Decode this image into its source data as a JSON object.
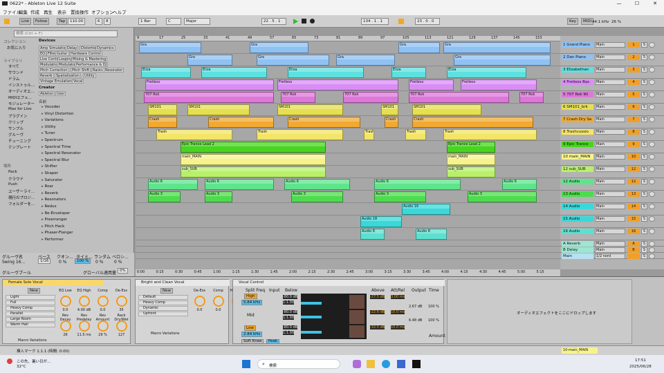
{
  "window": {
    "title": "0622* - Ableton Live 12 Suite",
    "min": "—",
    "max": "☐",
    "close": "✕"
  },
  "menu": [
    "ファイル",
    "編集",
    "作成",
    "再生",
    "表示",
    "置換操作",
    "オプション",
    "ヘルプ"
  ],
  "control": {
    "link": "Link",
    "follow": "Follow",
    "tap": "Tap",
    "tempo": "110.00",
    "sig_num": "6",
    "sig_den": "8",
    "quant": "1 Bar",
    "key": "C",
    "scale": "Major",
    "position": "22 . 5 . 1",
    "loop_start": "134 . 1 . 1",
    "loop_len": "23 . 0 . 0",
    "key_btn": "Key",
    "midi_btn": "MIDI",
    "sample_rate": "44.1 kHz",
    "cpu": "26 %"
  },
  "browser": {
    "search_placeholder": "検索 (Ctrl + F)",
    "collections_header": "コレクション",
    "favorites": "お気に入り",
    "library_header": "ライブラリ",
    "library": [
      "すべて",
      "サウンド",
      "ドラム",
      "インストゥル...",
      "オーディオエ...",
      "MIDIエフェ...",
      "モジュレーター",
      "Max for Live",
      "プラグイン",
      "クリップ",
      "サンプル",
      "グルーヴ",
      "チューニング",
      "テンプレート"
    ],
    "places_header": "場所",
    "places": [
      "Pack",
      "クラウド",
      "Push",
      "ユーザーライ...",
      "現行のプロジ...",
      "フォルダーを..."
    ],
    "devices_header": "Devices",
    "tags": [
      "Amp Simulation",
      "Delay",
      "Distortion",
      "Dynamics",
      "EQ",
      "Filter",
      "Guitar",
      "Hardware Control",
      "Live Control",
      "Looping",
      "Mixing & Mastering",
      "Modulation",
      "Modulator",
      "Performance & DJ",
      "Pitch Correction",
      "Pitch Shift",
      "Racks",
      "Resonator",
      "Reverb",
      "Spatialization",
      "Utility",
      "Vintage Emulation",
      "Vocal"
    ],
    "creator_header": "Creator",
    "creators": [
      "Ableton",
      "User"
    ],
    "name_col": "名前",
    "items": [
      "Vocoder",
      "Vinyl Distortion",
      "Variations",
      "Utility",
      "Tuner",
      "Spectrum",
      "Spectral Time",
      "Spectral Resonator",
      "Spectral Blur",
      "Shifter",
      "Shaper",
      "Saturator",
      "Roar",
      "Reverb",
      "Resonators",
      "Redux",
      "Re-Enveloper",
      "Prearranger",
      "Pitch Hack",
      "Phaser-Flanger",
      "Performer"
    ]
  },
  "groove": {
    "headers": [
      "グルーヴ名",
      "ベース",
      "クオン...",
      "タイミ...",
      "ランダム",
      "ベロシ..."
    ],
    "row": {
      "name": "Swing 16...",
      "base": "1/16",
      "quant": "0 %",
      "timing": "100 %",
      "random": "0 %",
      "velocity": "0 %"
    },
    "pool": "グルーヴプール",
    "global_amount_label": "グローバル適用量",
    "global_amount": "0%"
  },
  "ruler": [
    "9",
    "17",
    "25",
    "33",
    "41",
    "49",
    "57",
    "65",
    "73",
    "81",
    "89",
    "97",
    "105",
    "113",
    "121",
    "129",
    "137",
    "145",
    "153"
  ],
  "timeline": [
    "0:00",
    "0:15",
    "0:30",
    "0:45",
    "1:00",
    "1:15",
    "1:30",
    "1:45",
    "2:00",
    "2:15",
    "2:30",
    "2:45",
    "3:00",
    "3:15",
    "3:30",
    "3:45",
    "4:00",
    "4:15",
    "4:30",
    "4:45",
    "5:00",
    "5:15"
  ],
  "tracks": [
    {
      "name": "1 Grand Piano",
      "io": "Main",
      "num": "1",
      "color": "#8fc1f3",
      "clip": "Gra"
    },
    {
      "name": "2 Dan Piano",
      "io": "Main",
      "num": "2",
      "color": "#8fc1f3",
      "clip": "Gra"
    },
    {
      "name": "3 Elizabethan",
      "io": "Main",
      "num": "3",
      "color": "#5de0e0",
      "clip": "Eliza"
    },
    {
      "name": "4 Fretless Bas",
      "io": "Main",
      "num": "4",
      "color": "#d98ef5",
      "clip": "Fretless"
    },
    {
      "name": "5 707 Rok Wi",
      "io": "Main",
      "num": "5",
      "color": "#dd77d9",
      "clip": "707 Rok"
    },
    {
      "name": "6 SM101_brk",
      "io": "Main",
      "num": "6",
      "color": "#e6df4f",
      "clip": "SM101"
    },
    {
      "name": "7 Crash Dry Sa",
      "io": "Main",
      "num": "7",
      "color": "#f1a932",
      "clip": "Crash"
    },
    {
      "name": "8 Trashcussio",
      "io": "Main",
      "num": "8",
      "color": "#f3e566",
      "clip": "Trash"
    },
    {
      "name": "9 Epic Trance",
      "io": "Main",
      "num": "9",
      "color": "#47d61e",
      "clip": "Epic Trance Lead 2"
    },
    {
      "name": "10 main_MAIN",
      "io": "Main",
      "num": "10",
      "color": "#f6f38d",
      "clip": "main_MAIN"
    },
    {
      "name": "12 sub_SUB",
      "io": "Main",
      "num": "12",
      "color": "#b8f06a",
      "clip": "sub_SUB"
    },
    {
      "name": "12 Audio",
      "io": "Main",
      "num": "12",
      "color": "#5ee58b",
      "clip": "Audio 6"
    },
    {
      "name": "13 Audio",
      "io": "Main",
      "num": "13",
      "color": "#4ddc4d",
      "clip": "Audio 3"
    },
    {
      "name": "14 Audio",
      "io": "Main",
      "num": "14",
      "color": "#3ad8d8",
      "clip": "Audio 16"
    },
    {
      "name": "15 Audio",
      "io": "Main",
      "num": "15",
      "color": "#3ad8d8",
      "clip": "Audio 18"
    },
    {
      "name": "16 Audio",
      "io": "Main",
      "num": "16",
      "color": "#5de0d0",
      "clip": "Audio 8"
    },
    {
      "name": "A Reverb",
      "io": "Main",
      "num": "A",
      "color": "#9ce6d3",
      "clip": ""
    },
    {
      "name": "B Delay",
      "io": "Main",
      "num": "B",
      "color": "#9ce6d3",
      "clip": ""
    },
    {
      "name": "Main",
      "io": "1/2 nord",
      "num": "",
      "color": "#b8e0f3",
      "clip": ""
    }
  ],
  "devices": {
    "rack1": {
      "title": "Female Solo Vocal",
      "chains": [
        "Light",
        "Full",
        "Heavy Comp",
        "Parallel",
        "Large Room",
        "Warm Hall"
      ],
      "new": "New",
      "macro_footer": "Macro Variations",
      "macros": [
        {
          "label": "EQ Low",
          "val": "0.0"
        },
        {
          "label": "EQ High",
          "val": "4.00 dB"
        },
        {
          "label": "Comp",
          "val": "0.0"
        },
        {
          "label": "De-Ess",
          "val": "35"
        },
        {
          "label": "Rev Decay",
          "val": "26"
        },
        {
          "label": "Rev Predelay",
          "val": "11.5 ms"
        },
        {
          "label": "Rev Amount",
          "val": "29 %"
        },
        {
          "label": "Rack Dry/Wet",
          "val": "127"
        }
      ]
    },
    "rack2": {
      "title": "Bright and Clean Vocal",
      "chains": [
        "Default",
        "Heavy Comp",
        "Dynamic",
        "Upfront"
      ],
      "new": "New",
      "macro_footer": "Macro Variations",
      "macros": [
        {
          "label": "De-Ess",
          "val": "0.0"
        },
        {
          "label": "Comp",
          "val": "0.0"
        },
        {
          "label": "High EQ",
          "val": "77"
        },
        {
          "label": "Air",
          "val": "51"
        }
      ]
    },
    "vocal": {
      "title": "Vocal Control",
      "split": "Split Freq",
      "high": "High",
      "high_val": "5.84 kHz",
      "mid": "Mid",
      "low": "Low",
      "low_val": "2.84 kHz",
      "soft": "Soft Knee",
      "peak": "Peak",
      "input": "Input",
      "below": "Below",
      "above": "Above",
      "attrel": "Att/Rel",
      "output": "Output",
      "time": "Time",
      "amount": "Amount",
      "rows": [
        {
          "b": "-80.0 dB",
          "r": "1:1.00",
          "a": "-27.5 dB",
          "ar": "3.00 ms"
        },
        {
          "b": "-80.0 dB",
          "r": "1:1.00",
          "a": "-22.6 dB",
          "ar": "10.0 ms"
        },
        {
          "b": "-80.0 dB",
          "r": "1:1.00",
          "a": "-32.5 dB",
          "ar": "10.0 ms"
        }
      ],
      "out_vals": [
        "2.67 dB",
        "6.48 dB",
        "100 %",
        "100 %"
      ]
    },
    "drop_hint": "オーディオエフェクトをここにドロップします"
  },
  "status": {
    "left": "挿入マーク 1.1.1 (時間: 0:00)",
    "right_track": "10-main_MAIN"
  },
  "taskbar": {
    "weather_title": "この先、暑い日が...",
    "weather_temp": "32°C",
    "search": "検索",
    "time": "17:51",
    "date": "2025/06/28"
  }
}
